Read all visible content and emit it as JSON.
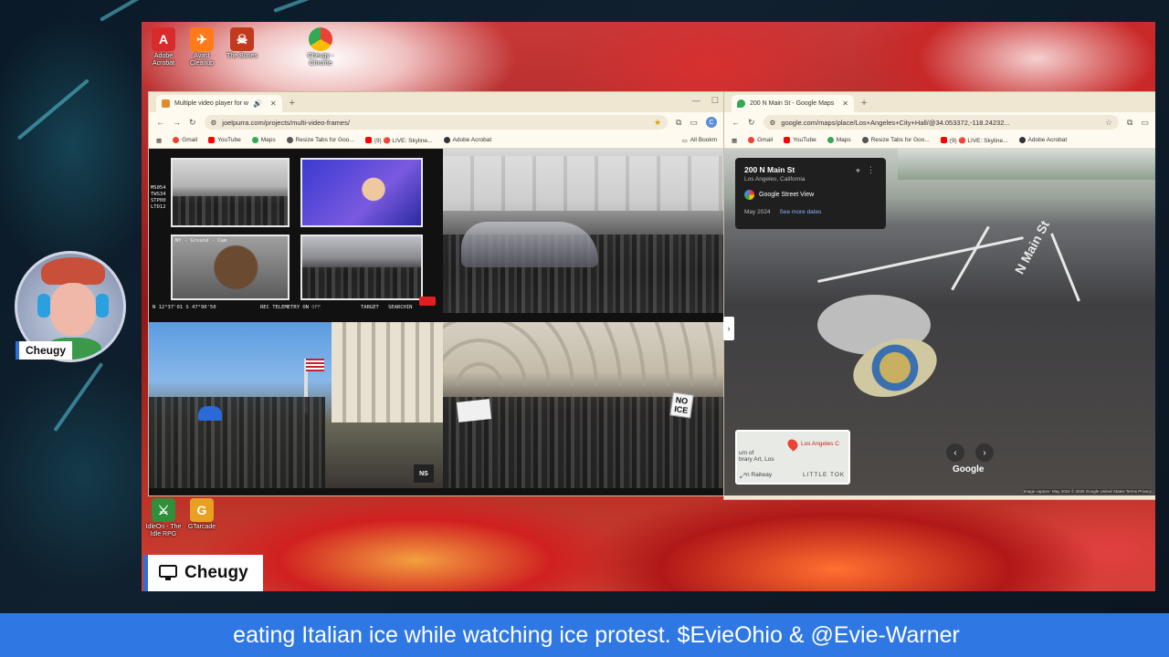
{
  "desktop_icons_top": [
    {
      "label": "Adobe\nAcrobat",
      "icon": "acrobat-icon",
      "color": "#d92b2b",
      "glyph": "A"
    },
    {
      "label": "Avast\nCleanup",
      "icon": "avast-cleanup-icon",
      "color": "#ff7a1a",
      "glyph": "✈"
    },
    {
      "label": "The Bones",
      "icon": "the-bones-icon",
      "color": "#c23a1e",
      "glyph": "☠"
    },
    {
      "label": "Cheugy -\nChrome",
      "icon": "chrome-icon",
      "color": "#4285f4",
      "glyph": "◉"
    }
  ],
  "desktop_icons_bottom": [
    {
      "label": "IdleOn - The\nIdle RPG",
      "icon": "idleon-icon",
      "color": "#2f8f3a",
      "glyph": "⚔"
    },
    {
      "label": "GTarcade",
      "icon": "gtarcade-icon",
      "color": "#e8a020",
      "glyph": "G"
    }
  ],
  "left_browser": {
    "tab_title": "Multiple video player for w",
    "new_tab": "+",
    "url": "joelpurra.com/projects/multi-video-frames/",
    "profile": "C",
    "bookmarks": [
      {
        "label": "Gmail",
        "color": "#ea4335"
      },
      {
        "label": "YouTube",
        "color": "#ff0000"
      },
      {
        "label": "Maps",
        "color": "#34a853"
      },
      {
        "label": "Resize Tabs for Goo...",
        "color": "#555555"
      },
      {
        "label": "(9) 🔴 LIVE: Skyline...",
        "color": "#ff0000"
      },
      {
        "label": "Adobe Acrobat",
        "color": "#333333"
      }
    ],
    "bookmarks_right": "All Bookm",
    "hud_left": "MS054\nTWS34\nSTP00\nLTD12",
    "hud_bottom": "N 12°37'01 S 47°90'50",
    "hud_telemetry": "REC TELEMETRY ON",
    "hud_telemetry_off": "OFF",
    "hud_target": "TARGET",
    "hud_search": "SEARCHIN",
    "hud_cam": "NY - Ground - Cam",
    "sign_text": "NO\nICE"
  },
  "right_browser": {
    "tab_title": "200 N Main St - Google Maps",
    "new_tab": "+",
    "url": "google.com/maps/place/Los+Angeles+City+Hall/@34.053372,-118.24232...",
    "bookmarks": [
      {
        "label": "Gmail",
        "color": "#ea4335"
      },
      {
        "label": "YouTube",
        "color": "#ff0000"
      },
      {
        "label": "Maps",
        "color": "#34a853"
      },
      {
        "label": "Resize Tabs for Goo...",
        "color": "#555555"
      },
      {
        "label": "(9) 🔴 LIVE: Skyline...",
        "color": "#ff0000"
      },
      {
        "label": "Adobe Acrobat",
        "color": "#333333"
      }
    ],
    "card": {
      "address": "200 N Main St",
      "city": "Los Angeles, California",
      "service": "Google Street View",
      "date": "May 2024",
      "more": "See more dates"
    },
    "street_label": "N Main St",
    "minimap_place": "Los Angeles C",
    "minimap_museum": "um of\nbrary Art, Los",
    "minimap_rail": "n Railway",
    "minimap_area": "LITTLE TOK",
    "google_logo": "Google",
    "footer": "Image capture: May 2024   © 2025 Google   United States   Terms   Privacy"
  },
  "overlay": {
    "avatar_name": "Cheugy",
    "camera_name": "Cheugy",
    "ticker": "eating Italian ice while watching ice protest.  $EvieOhio & @Evie-Warner"
  },
  "colors": {
    "ticker_bg": "#2f78e4",
    "accent": "#2f6fd8"
  }
}
